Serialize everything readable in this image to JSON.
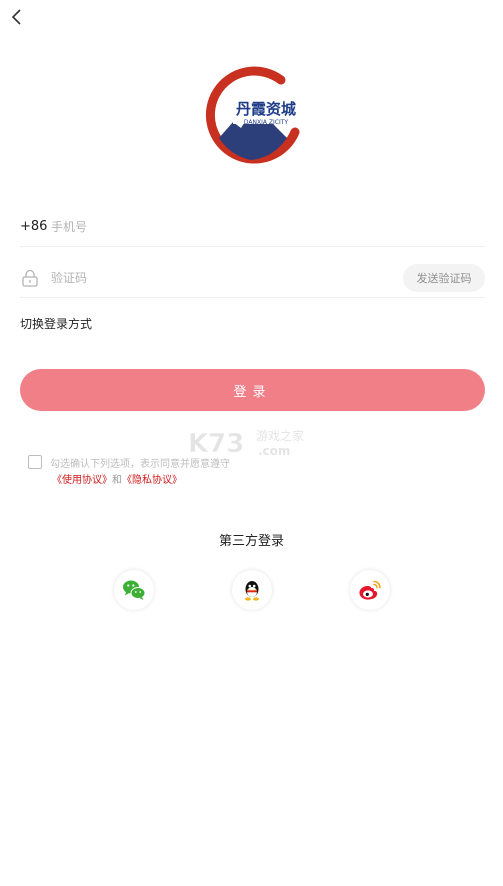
{
  "logo": {
    "name_cn": "丹霞资城",
    "name_en": "DANXIA ZICITY"
  },
  "phone": {
    "country_code": "+86",
    "placeholder": "手机号"
  },
  "code": {
    "placeholder": "验证码",
    "send_label": "发送验证码"
  },
  "switch_label": "切换登录方式",
  "login_label": "登录",
  "watermark": {
    "brand": "K73",
    "cn": "游戏之家",
    "dotcom": ".com"
  },
  "agreement": {
    "line1": "勾选确认下列选项，表示同意并愿意遵守",
    "terms": "《使用协议》",
    "and": "和",
    "privacy": "《隐私协议》"
  },
  "third_party": {
    "title": "第三方登录"
  },
  "colors": {
    "accent": "#f07f87",
    "link": "#d11a1a"
  },
  "icons": [
    "back-arrow-icon",
    "lock-icon",
    "wechat-icon",
    "qq-icon",
    "weibo-icon"
  ]
}
